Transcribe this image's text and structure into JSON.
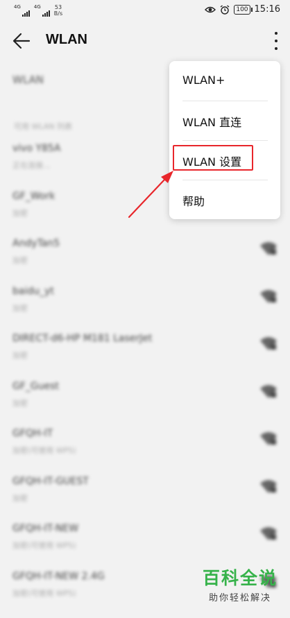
{
  "status_bar": {
    "network_1": "4G",
    "network_2": "4G",
    "speed_value": "53",
    "speed_unit": "B/s",
    "battery": "100",
    "time": "15:16"
  },
  "app_bar": {
    "title": "WLAN"
  },
  "wlan_toggle": {
    "label": "WLAN"
  },
  "section_header": "可用 WLAN 列表",
  "networks": [
    {
      "ssid": "vivo Y85A",
      "status": "正在连接..."
    },
    {
      "ssid": "GF_Work",
      "status": "加密"
    },
    {
      "ssid": "AndyTan5",
      "status": "加密"
    },
    {
      "ssid": "baidu_yt",
      "status": "加密"
    },
    {
      "ssid": "DIRECT-d6-HP M181 LaserJet",
      "status": "加密"
    },
    {
      "ssid": "GF_Guest",
      "status": "加密"
    },
    {
      "ssid": "GFQH-IT",
      "status": "加密(可使用 WPS)"
    },
    {
      "ssid": "GFQH-IT-GUEST",
      "status": "加密"
    },
    {
      "ssid": "GFQH-IT-NEW",
      "status": "加密(可使用 WPS)"
    },
    {
      "ssid": "GFQH-IT-NEW 2.4G",
      "status": "加密(可使用 WPS)"
    }
  ],
  "menu": {
    "items": [
      {
        "label": "WLAN+"
      },
      {
        "label": "WLAN 直连"
      },
      {
        "label": "WLAN 设置"
      },
      {
        "label": "帮助"
      }
    ]
  },
  "annotation": {
    "highlight_color": "#e8262b"
  },
  "watermark": {
    "title": "百科全说",
    "subtitle": "助你轻松解决",
    "color": "#36b24a"
  }
}
